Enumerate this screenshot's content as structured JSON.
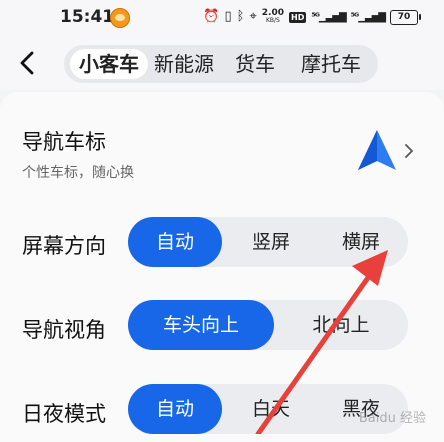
{
  "status_bar": {
    "time": "15:41",
    "net_speed": "2.00",
    "net_unit": "KB/S",
    "hd_label": "HD",
    "signal_1": "⁵ᴳ",
    "signal_2": "⁵ᴳ",
    "battery": "70"
  },
  "header": {
    "tabs": [
      {
        "label": "小客车",
        "active": true
      },
      {
        "label": "新能源",
        "active": false
      },
      {
        "label": "货车",
        "active": false
      },
      {
        "label": "摩托车",
        "active": false
      }
    ]
  },
  "nav_icon_setting": {
    "title": "导航车标",
    "subtitle": "个性车标，随心换"
  },
  "settings": [
    {
      "label": "屏幕方向",
      "options": [
        "自动",
        "竖屏",
        "横屏"
      ],
      "selected": "自动"
    },
    {
      "label": "导航视角",
      "options": [
        "车头向上",
        "北向上"
      ],
      "selected": "车头向上"
    },
    {
      "label": "日夜模式",
      "options": [
        "自动",
        "白天",
        "黑夜"
      ],
      "selected": "自动"
    }
  ],
  "colors": {
    "accent": "#1767e8",
    "annotation_arrow": "#e8413c"
  },
  "icons": {
    "back": "chevron-left-icon",
    "nav_marker": "navigation-arrow-icon",
    "chevron": "chevron-right-icon"
  },
  "watermark": "Baidu 经验"
}
